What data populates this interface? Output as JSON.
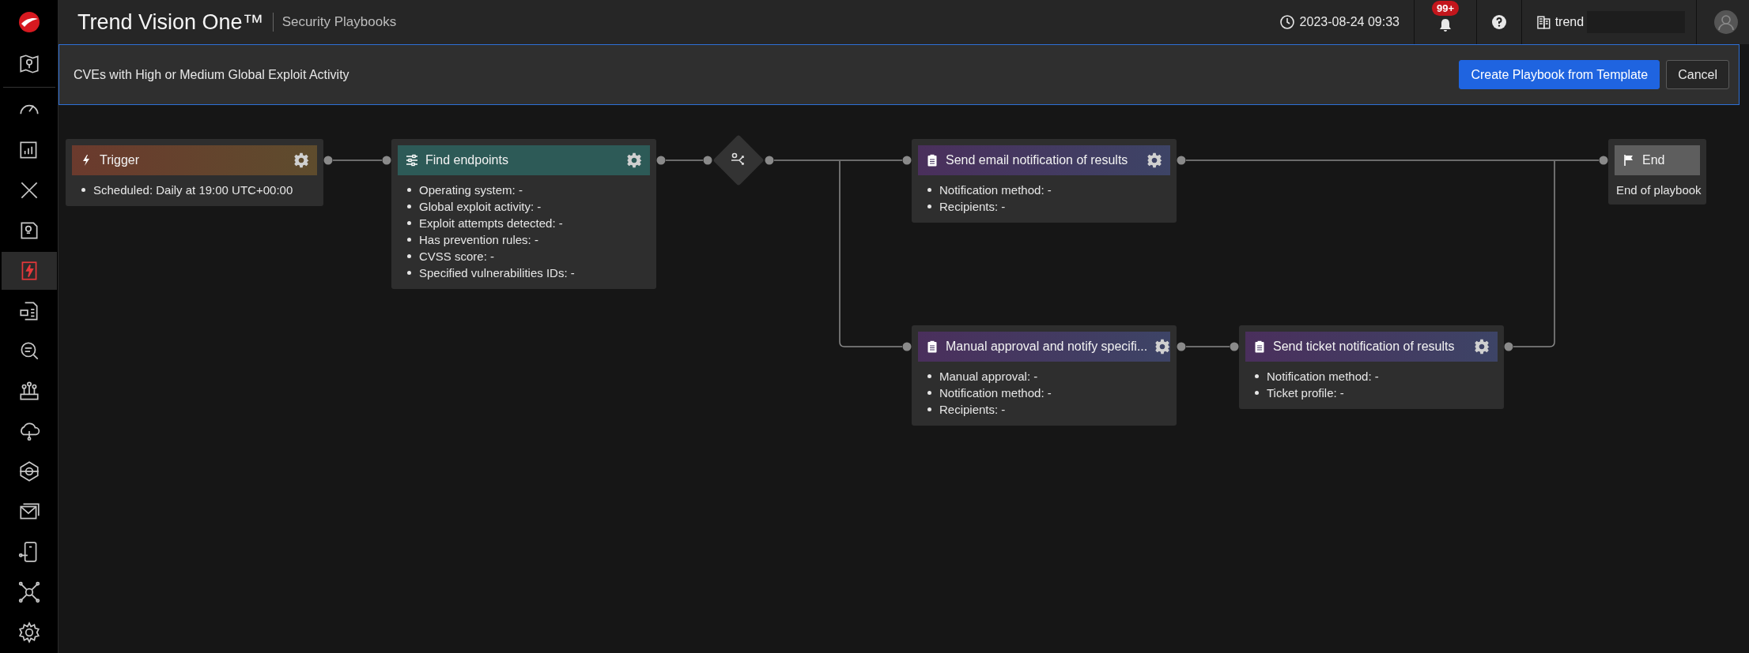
{
  "header": {
    "product": "Trend Vision One™",
    "page": "Security Playbooks",
    "datetime": "2023-08-24 09:33",
    "notifications": "99+",
    "tenant": "trend"
  },
  "sidebar": {
    "items": [
      {
        "selected": false
      },
      {
        "selected": false
      },
      {
        "selected": false
      },
      {
        "selected": false
      },
      {
        "selected": false
      },
      {
        "selected": true
      },
      {
        "selected": false
      },
      {
        "selected": false
      },
      {
        "selected": false
      },
      {
        "selected": false
      },
      {
        "selected": false
      },
      {
        "selected": false
      },
      {
        "selected": false
      },
      {
        "selected": false
      },
      {
        "selected": false
      }
    ]
  },
  "banner": {
    "title": "CVEs with High or Medium Global Exploit Activity",
    "buttons": [
      {
        "label": "Create Playbook from Template",
        "kind": "primary"
      },
      {
        "label": "Cancel",
        "kind": "secondary"
      }
    ]
  },
  "nodes": [
    {
      "kind": "trigger",
      "title": "Trigger",
      "items": [
        "Scheduled: Daily at 19:00 UTC+00:00"
      ]
    },
    {
      "kind": "filter",
      "title": "Find endpoints",
      "items": [
        "Operating system: -",
        "Global exploit activity: -",
        "Exploit attempts detected: -",
        "Has prevention rules: -",
        "CVSS score: -",
        "Specified vulnerabilities IDs: -"
      ]
    },
    {
      "kind": "branch"
    },
    {
      "kind": "action",
      "title": "Send email notification of results",
      "items": [
        "Notification method: -",
        "Recipients: -"
      ]
    },
    {
      "kind": "action",
      "title": "Manual approval and notify specifi...",
      "items": [
        "Manual approval: -",
        "Notification method: -",
        "Recipients: -"
      ]
    },
    {
      "kind": "action",
      "title": "Send ticket notification of results",
      "items": [
        "Notification method: -",
        "Ticket profile: -"
      ]
    },
    {
      "kind": "end",
      "title": "End",
      "description": "End of playbook"
    }
  ]
}
